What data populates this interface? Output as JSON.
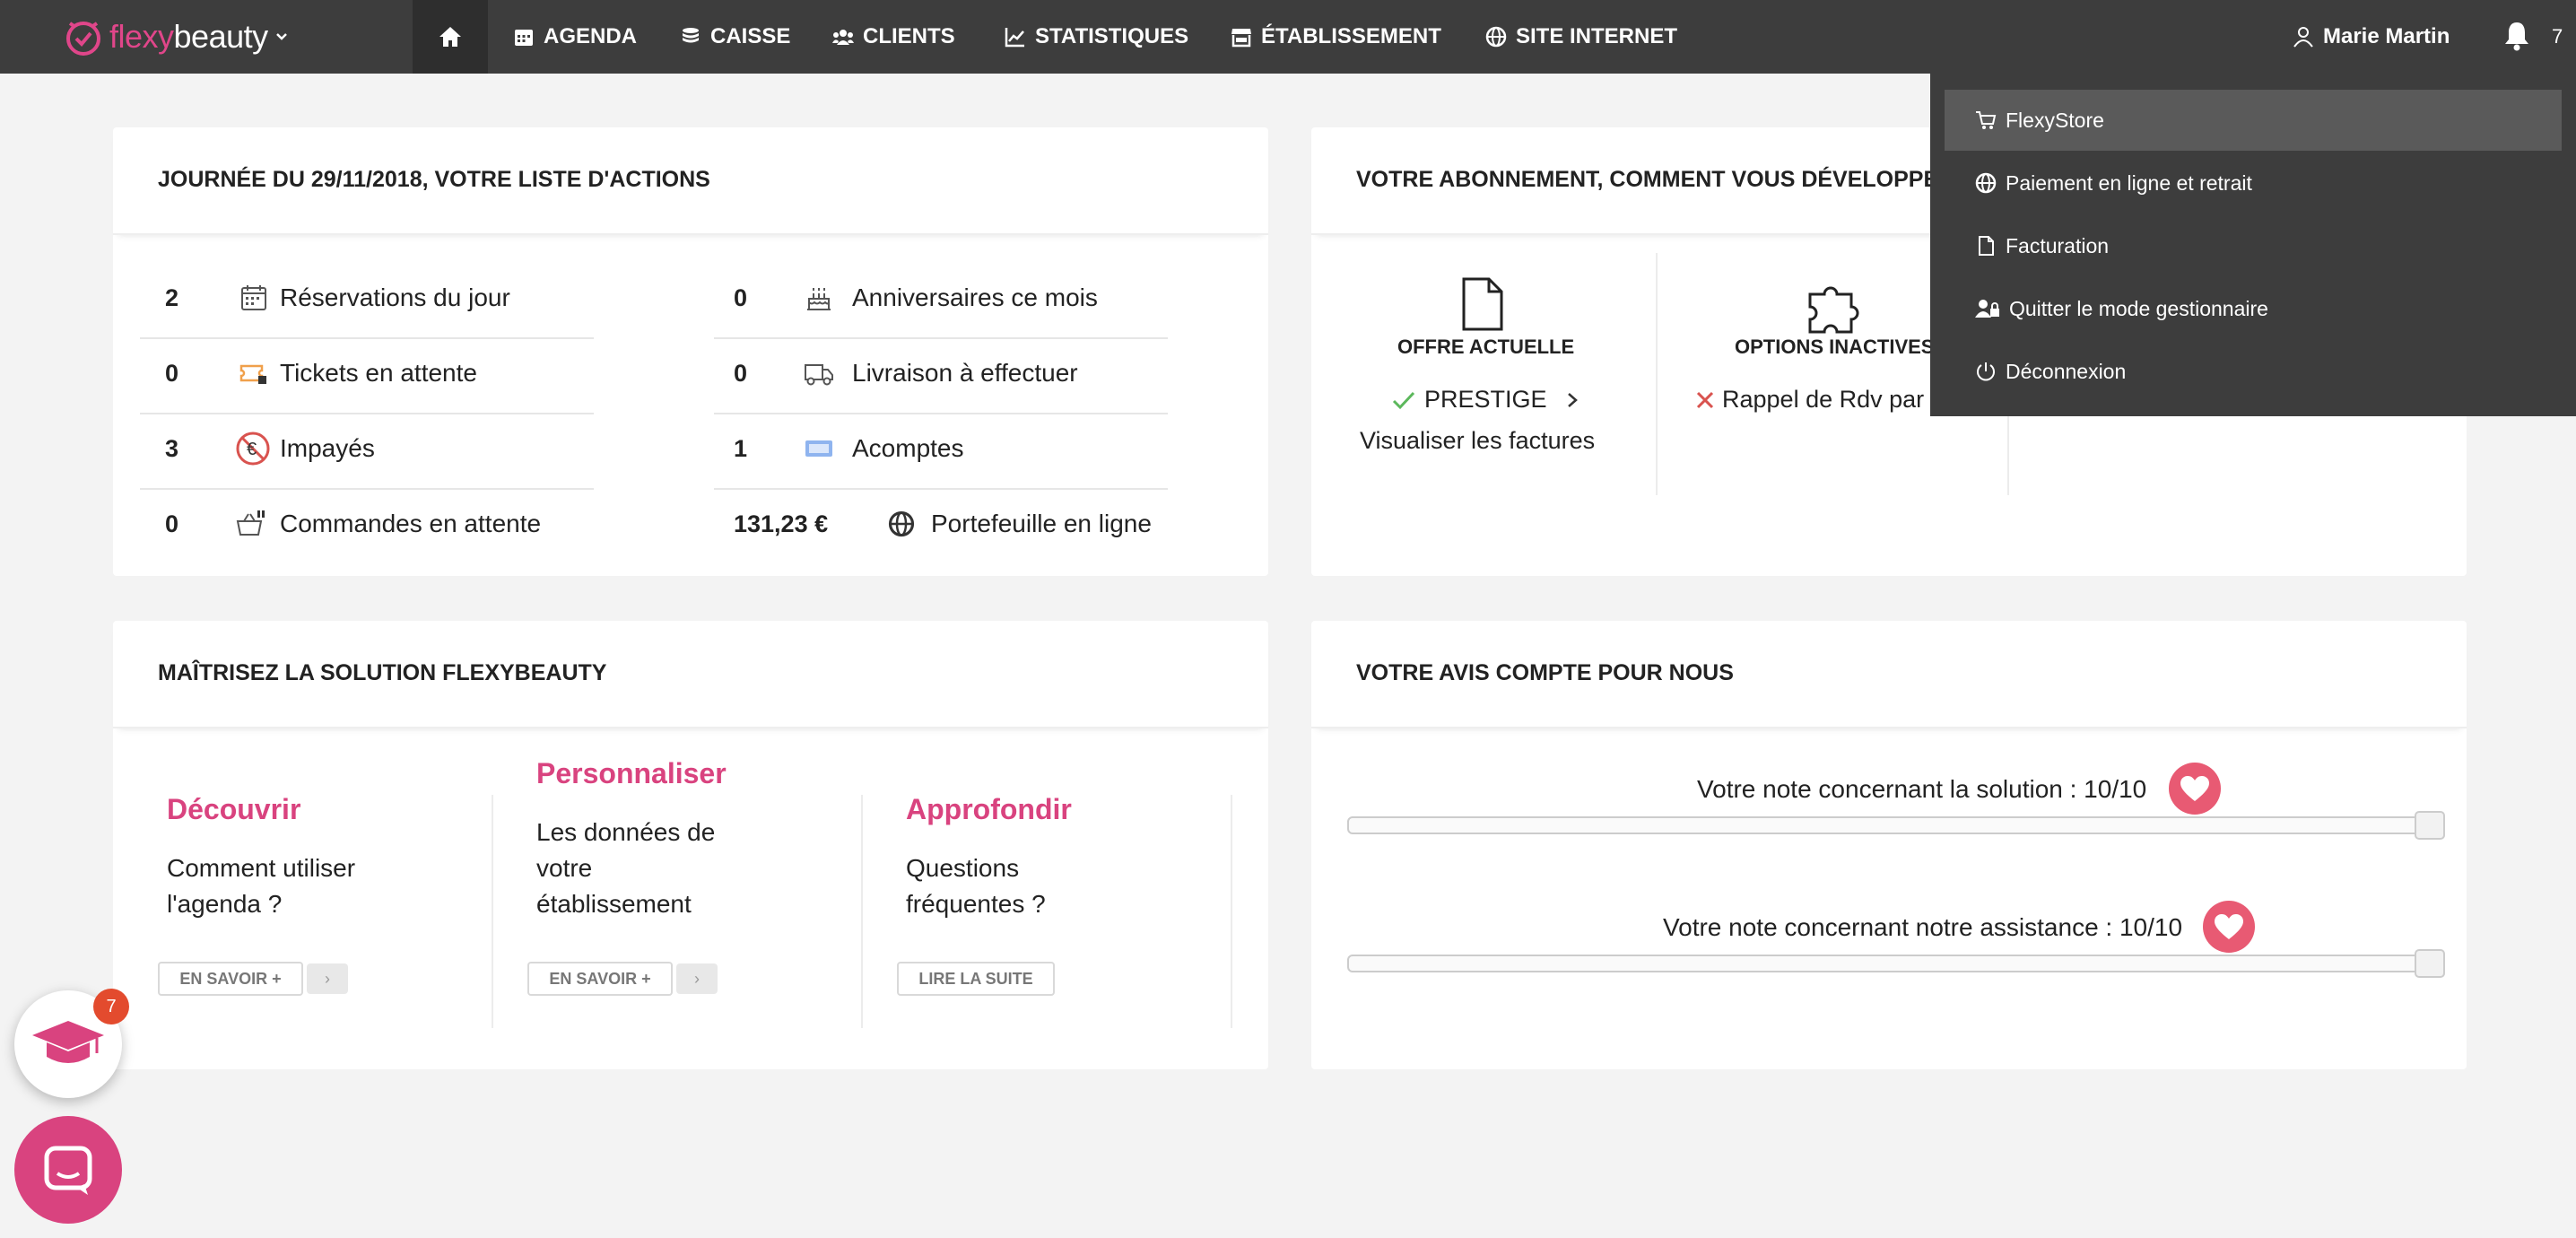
{
  "nav": {
    "logo_flexy": "flexy",
    "logo_beauty": "beauty",
    "items": [
      {
        "label": "AGENDA",
        "icon": "calendar-icon"
      },
      {
        "label": "CAISSE",
        "icon": "coins-icon"
      },
      {
        "label": "CLIENTS",
        "icon": "users-icon"
      },
      {
        "label": "STATISTIQUES",
        "icon": "chart-icon"
      },
      {
        "label": "ÉTABLISSEMENT",
        "icon": "store-icon"
      },
      {
        "label": "SITE INTERNET",
        "icon": "globe-icon"
      }
    ],
    "user_name": "Marie Martin",
    "notification_count": "7"
  },
  "dropdown": {
    "items": [
      {
        "label": "FlexyStore",
        "icon": "cart-icon",
        "active": true
      },
      {
        "label": "Paiement en ligne et retrait",
        "icon": "globe-icon"
      },
      {
        "label": "Facturation",
        "icon": "file-icon"
      },
      {
        "label": "Quitter le mode gestionnaire",
        "icon": "user-lock-icon"
      },
      {
        "label": "Déconnexion",
        "icon": "power-icon"
      }
    ]
  },
  "actions_card": {
    "title": "JOURNÉE DU 29/11/2018, VOTRE LISTE D'ACTIONS",
    "left": [
      {
        "value": "2",
        "label": "Réservations du jour",
        "icon": "calendar-icon"
      },
      {
        "value": "0",
        "label": "Tickets en attente",
        "icon": "ticket-icon"
      },
      {
        "value": "3",
        "label": "Impayés",
        "icon": "euro-slash-icon"
      },
      {
        "value": "0",
        "label": "Commandes en attente",
        "icon": "basket-icon"
      }
    ],
    "right": [
      {
        "value": "0",
        "label": "Anniversaires ce mois",
        "icon": "cake-icon"
      },
      {
        "value": "0",
        "label": "Livraison à effectuer",
        "icon": "truck-icon"
      },
      {
        "value": "1",
        "label": "Acomptes",
        "icon": "card-icon"
      },
      {
        "value": "131,23 €",
        "label": "Portefeuille en ligne",
        "icon": "globe-icon"
      }
    ]
  },
  "subscription_card": {
    "title": "VOTRE ABONNEMENT, COMMENT VOUS DÉVELOPPER",
    "current_offer_heading": "OFFRE ACTUELLE",
    "current_offer_name": "PRESTIGE",
    "invoices_link": "Visualiser les factures",
    "inactive_options_heading": "OPTIONS INACTIVES",
    "inactive_option": "Rappel de Rdv par s",
    "status_colors": {
      "active": "#5cb85c",
      "inactive": "#d9534f"
    }
  },
  "learn_card": {
    "title": "MAÎTRISEZ LA SOLUTION FLEXYBEAUTY",
    "columns": [
      {
        "title": "Découvrir",
        "lines": [
          "Comment utiliser",
          "l'agenda ?"
        ],
        "button": "EN SAVOIR +",
        "arrow": "›"
      },
      {
        "title": "Personnaliser",
        "lines": [
          "Les données de",
          "votre",
          "établissement"
        ],
        "button": "EN SAVOIR +",
        "arrow": "›"
      },
      {
        "title": "Approfondir",
        "lines": [
          "Questions",
          "fréquentes ?"
        ],
        "button": "LIRE LA SUITE"
      }
    ]
  },
  "feedback_card": {
    "title": "VOTRE AVIS COMPTE POUR NOUS",
    "ratings": [
      {
        "label": "Votre note concernant la solution : 10/10",
        "value": 10,
        "max": 10
      },
      {
        "label": "Votre note concernant notre assistance : 10/10",
        "value": 10,
        "max": 10
      }
    ]
  },
  "floating": {
    "academy_badge": "7"
  },
  "colors": {
    "brand": "#e0468a",
    "nav": "#3d3d3d",
    "heart": "#e85a73"
  }
}
